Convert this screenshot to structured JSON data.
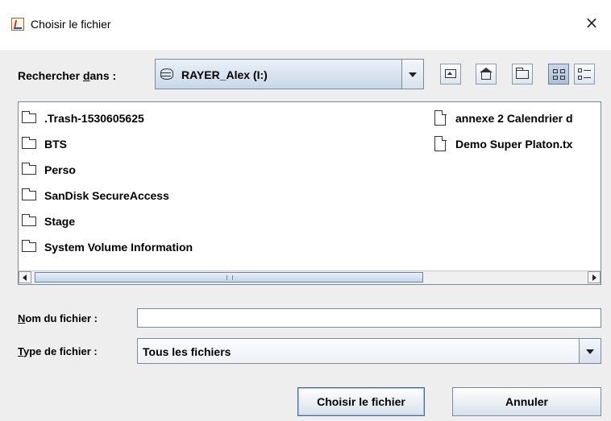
{
  "window": {
    "title": "Choisir le fichier",
    "close_glyph": "×",
    "icon": "java-cup-icon"
  },
  "lookin": {
    "label_before": "Rechercher ",
    "label_mnemonic": "d",
    "label_after": "ans :",
    "selected": "RAYER_Alex (I:)",
    "selected_icon": "drive-icon"
  },
  "toolbar": {
    "buttons": [
      "up-one-level",
      "home",
      "new-folder",
      "list-view",
      "details-view"
    ],
    "active": "list-view"
  },
  "files": {
    "column1": [
      {
        "name": ".Trash-1530605625",
        "type": "folder"
      },
      {
        "name": "BTS",
        "type": "folder"
      },
      {
        "name": "Perso",
        "type": "folder"
      },
      {
        "name": "SanDisk SecureAccess",
        "type": "folder"
      },
      {
        "name": "Stage",
        "type": "folder"
      },
      {
        "name": "System Volume Information",
        "type": "folder"
      }
    ],
    "column2": [
      {
        "name": "annexe 2 Calendrier d",
        "type": "file"
      },
      {
        "name": "Demo Super Platon.tx",
        "type": "file"
      }
    ]
  },
  "filename": {
    "label_mnemonic": "N",
    "label_after": "om du fichier :",
    "value": ""
  },
  "filetype": {
    "label_mnemonic": "T",
    "label_after": "ype de fichier :",
    "selected": "Tous les fichiers"
  },
  "actions": {
    "choose": "Choisir le fichier",
    "cancel": "Annuler"
  },
  "colors": {
    "dialog_bg": "#eeeeee",
    "button_gradient_top": "#ffffff",
    "button_gradient_bottom": "#d7e1ec",
    "combo_accent": "#c9d8e8"
  }
}
